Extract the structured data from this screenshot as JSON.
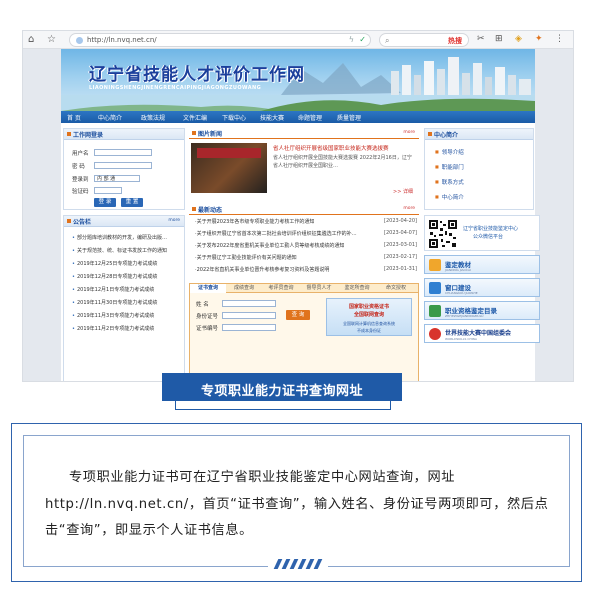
{
  "browser": {
    "url": "http://ln.nvq.net.cn/",
    "hot_label": "热搜"
  },
  "site": {
    "title": "辽宁省技能人才评价工作网",
    "pinyin": "LIAONINGSHENGJINENGRENCAIPINGJIAGONGZUOWANG",
    "nav": [
      "首 页",
      "中心简介",
      "政策法规",
      "文件汇编",
      "下载中心",
      "技能大赛",
      "命题管理",
      "质量管理"
    ]
  },
  "login": {
    "title": "工作网登录",
    "username_label": "用户名",
    "password_label": "密 码",
    "type_label": "登录到",
    "type_value": "内 部 通",
    "captcha_label": "验证码",
    "login_button": "登 录",
    "reset_button": "重 置"
  },
  "announcements": {
    "title": "公告栏",
    "more": "more",
    "items": [
      "部分题库培训教材的开发，编研及出版…",
      "关于规范技、统、标证书发放工作的通知",
      "2019年12月25日专项能力考试成绩",
      "2019年12月28日专项能力考试成绩",
      "2019年12月1日专项能力考试成绩",
      "2019年11月30日专项能力考试成绩",
      "2019年11月3日专项能力考试成绩",
      "2019年11月2日专项能力考试成绩"
    ]
  },
  "photo_news": {
    "title": "图片新闻",
    "more": "more",
    "headline": "省人社厅组织开展省级国家职业技能大赛选拔赛",
    "summary": "省人社厅组织开展全国技能大赛选拔赛 2022年2月16日，辽宁省人社厅组织开展全国职业…",
    "detail_link": ">> 详细"
  },
  "latest": {
    "title": "最新动态",
    "more": "more",
    "items": [
      {
        "title": "·关于开展2023年各市级专项职业能力考核工作的通知",
        "date": "[2023-04-20]"
      },
      {
        "title": "·关于组织开展辽宁省首本次第二批社会培训评价组织征集遴选工作的补…",
        "date": "[2023-04-07]"
      },
      {
        "title": "·关于发布2022年度省重机关事业单位工勤人员等级考核成绩的通知",
        "date": "[2023-03-01]"
      },
      {
        "title": "·关于开展辽宁工勤业技能评价有关问题的通知",
        "date": "[2023-02-17]"
      },
      {
        "title": "·2022年省直机关事业单位晋升考核参考复习资料及答题说明",
        "date": "[2023-01-31]"
      }
    ]
  },
  "cert_query": {
    "tabs": [
      "证书查询",
      "成绩查询",
      "考评员查询",
      "督导员人才",
      "鉴定所查询",
      "命文授权"
    ],
    "name_label": "姓  名",
    "id_label": "身份证号",
    "cert_label": "证书编号",
    "query_button": "查 询",
    "ad_line1": "国家职业资格证书",
    "ad_line2": "全国联网查询",
    "ad_line3": "全国联网计算机信息查询系统",
    "ad_line4": "不成本身份证"
  },
  "center": {
    "title": "中心简介",
    "items": [
      "领导介绍",
      "职能部门",
      "联系方式",
      "中心简介"
    ]
  },
  "qr": {
    "line1": "辽宁省职业技能鉴定中心",
    "line2": "公众微信平台"
  },
  "right_banners": [
    {
      "label": "鉴定教材",
      "sub": "JIANDING JIAOCAI"
    },
    {
      "label": "窗口建设",
      "sub": "CHUANGKOU JIANSHE"
    },
    {
      "label": "职业资格鉴定目录",
      "sub": "ZHIYEZIGEJIANDINGMULU"
    },
    {
      "label": "世界技能大赛中国组委会",
      "sub": "WORLDSKILLS CHINA"
    }
  ],
  "caption": "专项职业能力证书查询网址",
  "body_text": "专项职业能力证书可在辽宁省职业技能鉴定中心网站查询，网址http://ln.nvq.net.cn/，首页“证书查询”，输入姓名、身份证号两项即可，然后点击“查询”，即显示个人证书信息。",
  "colors": {
    "brand_blue": "#1f5aa7",
    "menu_blue": "#1a5ba6",
    "accent_orange": "#e0731d"
  }
}
